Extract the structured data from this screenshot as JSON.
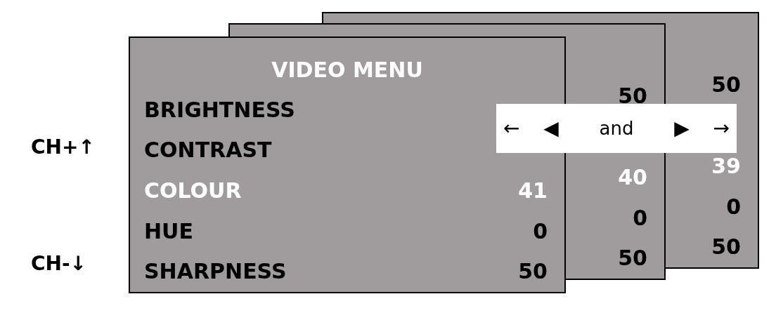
{
  "channel_keys": [
    "CH+↑",
    "CH-↓"
  ],
  "menus": [
    {
      "title": "VIDEO MENU",
      "rows": [
        {
          "label": "BRIGHTNESS",
          "highlighted": false
        },
        {
          "label": "CONTRAST",
          "highlighted": false
        },
        {
          "label": "COLOUR",
          "value": "41",
          "highlighted": true
        },
        {
          "label": "HUE",
          "value": "0",
          "highlighted": false
        },
        {
          "label": "SHARPNESS",
          "value": "50",
          "highlighted": false
        }
      ]
    },
    {
      "rows": [
        {
          "value": "50",
          "highlighted": false
        },
        {
          "value": "40",
          "highlighted": true
        },
        {
          "value": "0",
          "highlighted": false
        },
        {
          "value": "50",
          "highlighted": false
        }
      ]
    },
    {
      "rows": [
        {
          "value": "50",
          "highlighted": false
        },
        {
          "value": "39",
          "highlighted": true
        },
        {
          "value": "0",
          "highlighted": false
        },
        {
          "value": "50",
          "highlighted": false
        }
      ]
    }
  ],
  "nav_hint": [
    "←",
    "◀",
    "and",
    "▶",
    "→"
  ]
}
